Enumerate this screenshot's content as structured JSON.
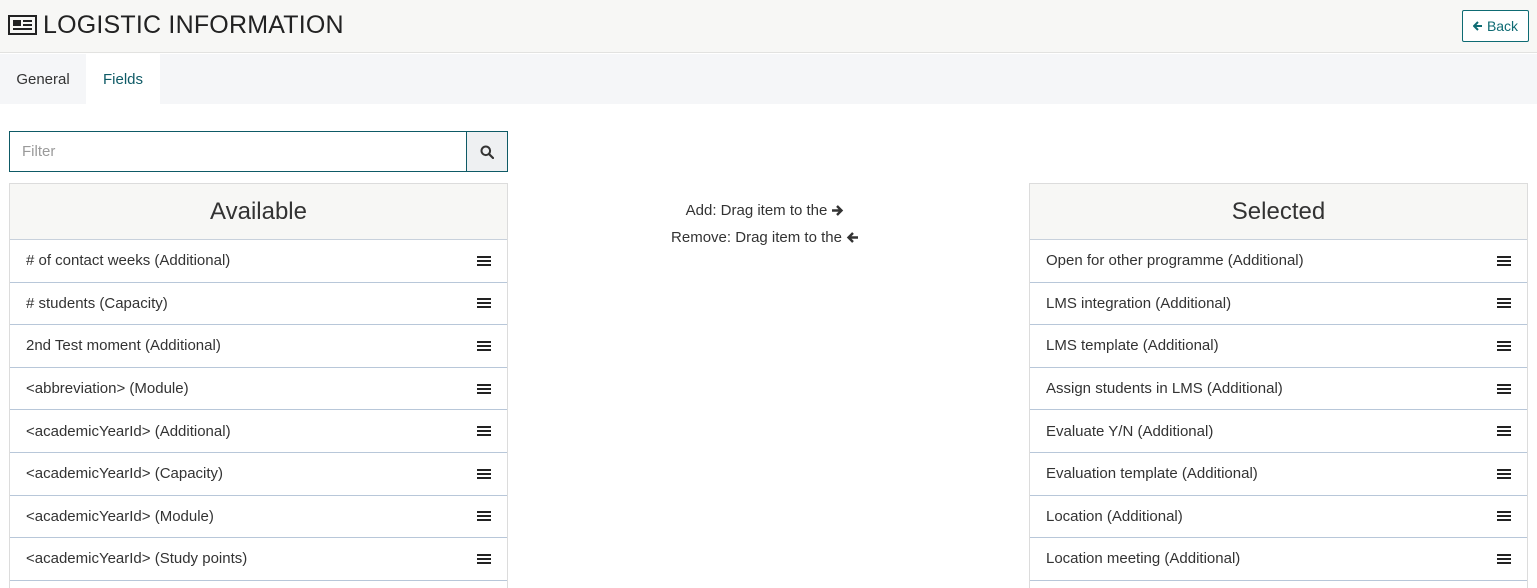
{
  "header": {
    "title": "LOGISTIC INFORMATION",
    "title_icon": "newspaper-icon",
    "back_label": "Back",
    "back_icon": "arrow-left-icon"
  },
  "tabs": [
    {
      "label": "General",
      "active": false
    },
    {
      "label": "Fields",
      "active": true
    }
  ],
  "filter": {
    "placeholder": "Filter",
    "value": "",
    "button_icon": "search-icon"
  },
  "available": {
    "title": "Available",
    "items": [
      "# of contact weeks (Additional)",
      "# students (Capacity)",
      "2nd Test moment (Additional)",
      "<abbreviation> (Module)",
      "<academicYearId> (Additional)",
      "<academicYearId> (Capacity)",
      "<academicYearId> (Module)",
      "<academicYearId> (Study points)"
    ]
  },
  "hints": {
    "add": "Add: Drag item to the",
    "add_icon": "arrow-right-icon",
    "remove": "Remove: Drag item to the",
    "remove_icon": "arrow-left-icon"
  },
  "selected": {
    "title": "Selected",
    "items": [
      "Open for other programme (Additional)",
      "LMS integration (Additional)",
      "LMS template (Additional)",
      "Assign students in LMS (Additional)",
      "Evaluate Y/N (Additional)",
      "Evaluation template (Additional)",
      "Location (Additional)",
      "Location meeting (Additional)"
    ]
  },
  "colors": {
    "accent": "#0e5a66",
    "header_bg": "#f7f7f5",
    "tabbar_bg": "#f5f6f8",
    "row_border": "#b8c7d9"
  }
}
